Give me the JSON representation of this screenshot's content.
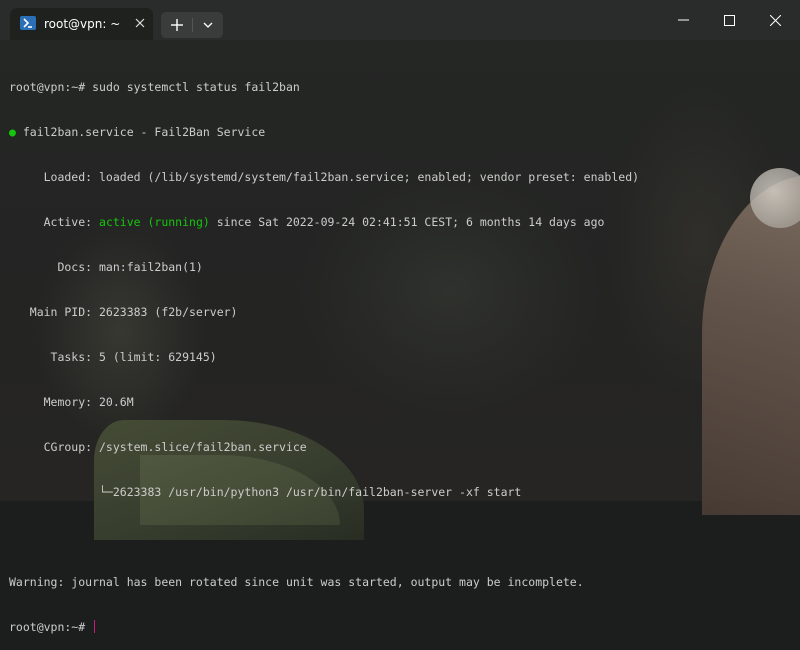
{
  "window": {
    "tab_title": "root@vpn: ~",
    "tab_icon": "powershell-icon",
    "controls": [
      "minimize-icon",
      "maximize-icon",
      "close-icon"
    ]
  },
  "terminal": {
    "prompt_1": "root@vpn:~# ",
    "command": "sudo systemctl status fail2ban",
    "service_dot": "●",
    "service_line": " fail2ban.service - Fail2Ban Service",
    "loaded": "     Loaded: loaded (/lib/systemd/system/fail2ban.service; enabled; vendor preset: enabled)",
    "active_label": "     Active: ",
    "active_state": "active (running)",
    "active_since": " since Sat 2022-09-24 02:41:51 CEST; 6 months 14 days ago",
    "docs": "       Docs: man:fail2ban(1)",
    "main_pid": "   Main PID: 2623383 (f2b/server)",
    "tasks": "      Tasks: 5 (limit: 629145)",
    "memory": "     Memory: 20.6M",
    "cgroup": "     CGroup: /system.slice/fail2ban.service",
    "cgroup_child": "             └─2623383 /usr/bin/python3 /usr/bin/fail2ban-server -xf start",
    "blank": "",
    "warning": "Warning: journal has been rotated since unit was started, output may be incomplete.",
    "prompt_2": "root@vpn:~# "
  },
  "colors": {
    "active_green": "#16c60c",
    "cursor": "#c2207b",
    "text": "#cccccc"
  }
}
